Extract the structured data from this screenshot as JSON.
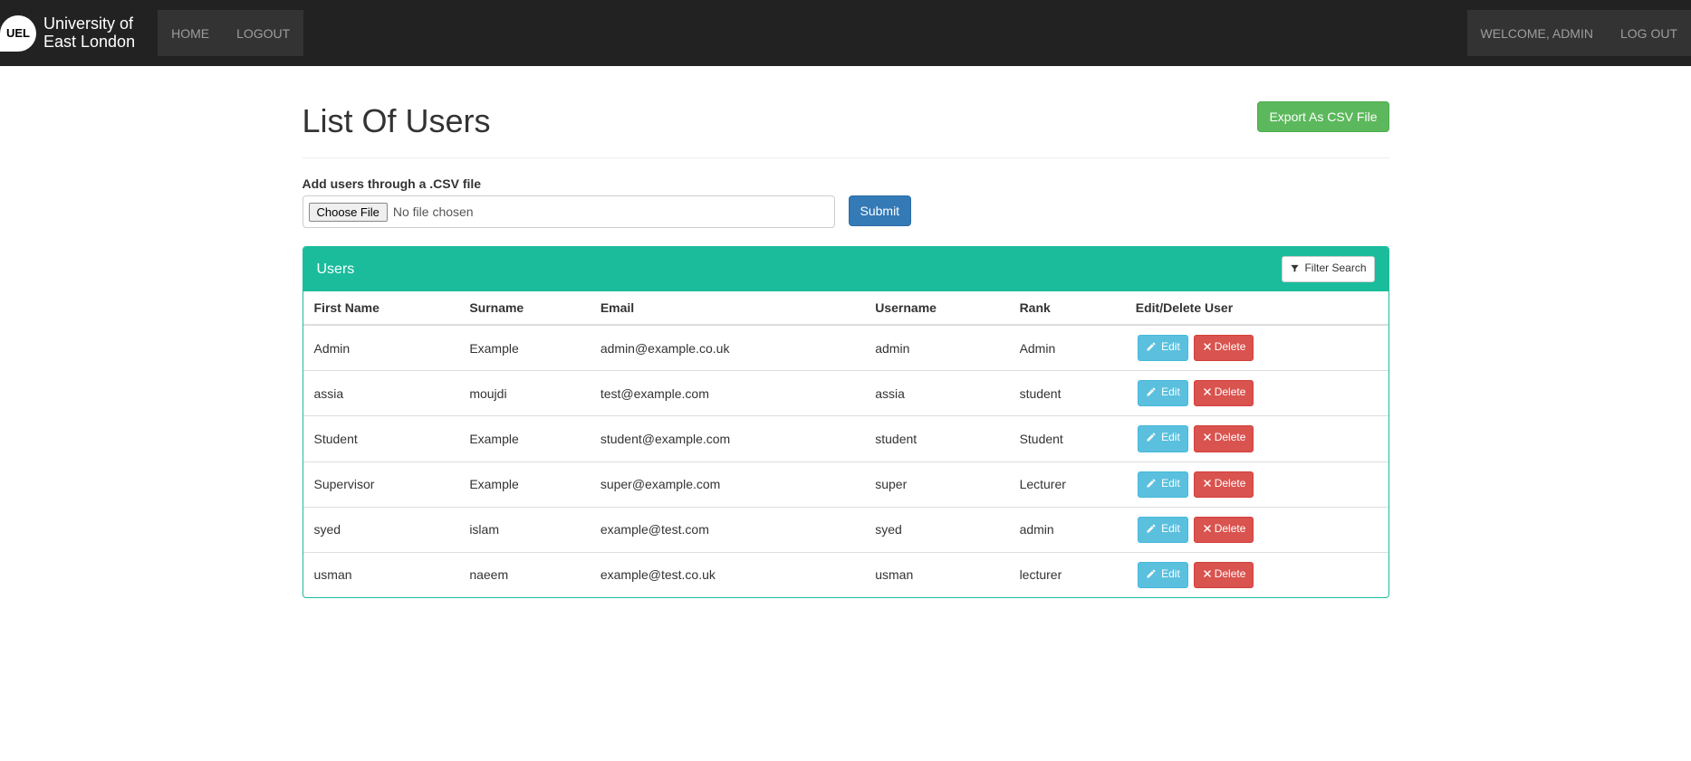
{
  "brand": {
    "badge_text": "UEL",
    "line1": "University of",
    "line2": "East London"
  },
  "nav": {
    "home": "HOME",
    "logout_left": "LOGOUT",
    "welcome": "WELCOME, ADMIN",
    "logout_right": "LOG OUT"
  },
  "page": {
    "title": "List Of Users",
    "export_button": "Export As CSV File"
  },
  "upload": {
    "label": "Add users through a .CSV file",
    "choose_button": "Choose File",
    "no_file": "No file chosen",
    "submit": "Submit"
  },
  "panel": {
    "title": "Users",
    "filter_button": "Filter Search"
  },
  "table": {
    "headers": {
      "first_name": "First Name",
      "surname": "Surname",
      "email": "Email",
      "username": "Username",
      "rank": "Rank",
      "actions": "Edit/Delete User"
    },
    "edit_label": "Edit",
    "delete_label": "Delete",
    "rows": [
      {
        "first_name": "Admin",
        "surname": "Example",
        "email": "admin@example.co.uk",
        "username": "admin",
        "rank": "Admin"
      },
      {
        "first_name": "assia",
        "surname": "moujdi",
        "email": "test@example.com",
        "username": "assia",
        "rank": "student"
      },
      {
        "first_name": "Student",
        "surname": "Example",
        "email": "student@example.com",
        "username": "student",
        "rank": "Student"
      },
      {
        "first_name": "Supervisor",
        "surname": "Example",
        "email": "super@example.com",
        "username": "super",
        "rank": "Lecturer"
      },
      {
        "first_name": "syed",
        "surname": "islam",
        "email": "example@test.com",
        "username": "syed",
        "rank": "admin"
      },
      {
        "first_name": "usman",
        "surname": "naeem",
        "email": "example@test.co.uk",
        "username": "usman",
        "rank": "lecturer"
      }
    ]
  }
}
